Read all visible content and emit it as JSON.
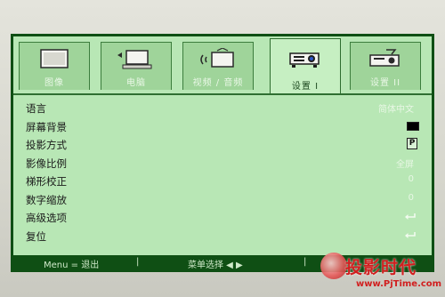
{
  "tabs": [
    {
      "label": "图像",
      "icon": "screen-icon",
      "active": false
    },
    {
      "label": "电脑",
      "icon": "computer-icon",
      "active": false
    },
    {
      "label": "视频 / 音频",
      "icon": "video-audio-icon",
      "active": false
    },
    {
      "label": "设置 I",
      "icon": "projector-icon",
      "active": true
    },
    {
      "label": "设置 II",
      "icon": "projector-settings-icon",
      "active": false
    }
  ],
  "menu_items": [
    {
      "label": "语言",
      "value": "简体中文",
      "type": "text"
    },
    {
      "label": "屏幕背景",
      "value": "",
      "type": "swatch",
      "swatch_color": "#000000"
    },
    {
      "label": "投影方式",
      "value": "P",
      "type": "boxed"
    },
    {
      "label": "影像比例",
      "value": "全屏",
      "type": "text"
    },
    {
      "label": "梯形校正",
      "value": "0",
      "type": "text"
    },
    {
      "label": "数字缩放",
      "value": "0",
      "type": "text"
    },
    {
      "label": "高级选项",
      "value": "",
      "type": "enter"
    },
    {
      "label": "复位",
      "value": "",
      "type": "enter"
    }
  ],
  "footer": {
    "exit_label": "Menu = 退出",
    "sep1": "|",
    "select_label": "菜单选择 ◀ ▶",
    "sep2": "|"
  },
  "watermark": {
    "brand": "投影时代",
    "url": "www.PjTime.com"
  },
  "colors": {
    "frame": "#0f4f14",
    "panel": "#b8e7b5",
    "active_tab": "#c6efc2",
    "inactive_tab": "#9fd49a",
    "watermark": "#d11f1f"
  }
}
